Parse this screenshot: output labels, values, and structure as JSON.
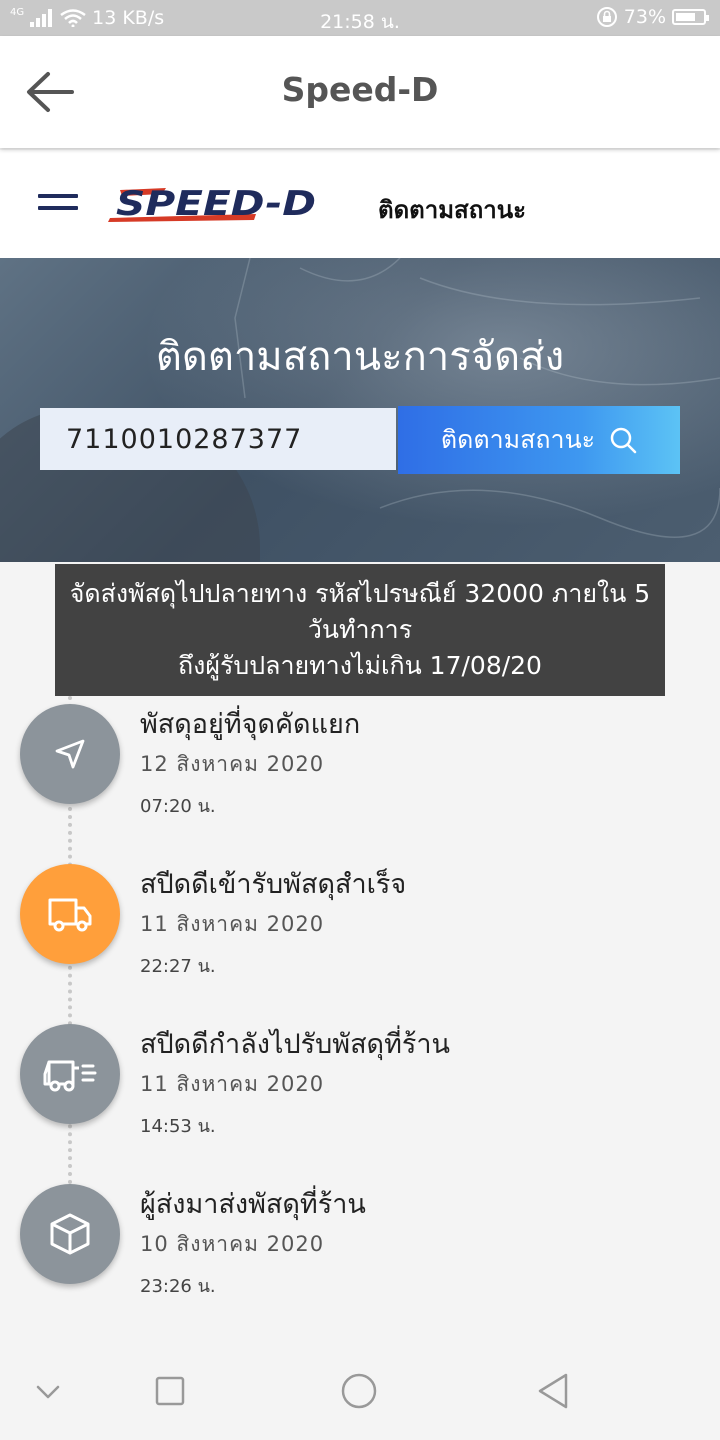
{
  "status_bar": {
    "network": "4G",
    "speed": "13 KB/s",
    "time": "21:58 น.",
    "battery": "73%",
    "battery_level": 0.73
  },
  "app_bar": {
    "title": "Speed-D"
  },
  "site_header": {
    "logo_text": "SPEED-D",
    "nav_label": "ติดตามสถานะ"
  },
  "hero": {
    "title": "ติดตามสถานะการจัดส่ง",
    "tracking_value": "7110010287377",
    "button_label": "ติดตามสถานะ"
  },
  "banner": {
    "line1": "จัดส่งพัสดุไปปลายทาง รหัสไปรษณีย์ 32000 ภายใน 5",
    "line2": "วันทำการ",
    "line3": "ถึงผู้รับปลายทางไม่เกิน 17/08/20"
  },
  "timeline": [
    {
      "title": "พัสดุอยู่ที่จุดคัดแยก",
      "date": "12 สิงหาคม 2020",
      "time": "07:20 น.",
      "icon": "navigation-arrow-icon",
      "active": false
    },
    {
      "title": "สปีดดีเข้ารับพัสดุสำเร็จ",
      "date": "11 สิงหาคม 2020",
      "time": "22:27 น.",
      "icon": "truck-icon",
      "active": true
    },
    {
      "title": "สปีดดีกำลังไปรับพัสดุที่ร้าน",
      "date": "11 สิงหาคม 2020",
      "time": "14:53 น.",
      "icon": "fast-truck-icon",
      "active": false
    },
    {
      "title": "ผู้ส่งมาส่งพัสดุที่ร้าน",
      "date": "10 สิงหาคม 2020",
      "time": "23:26 น.",
      "icon": "package-box-icon",
      "active": false
    }
  ],
  "colors": {
    "accent_orange": "#ff9f3b",
    "inactive_gray": "#8c949b",
    "logo_red": "#d63a26",
    "logo_navy": "#1f2b5c",
    "button_blue": "#2f6ee6"
  }
}
